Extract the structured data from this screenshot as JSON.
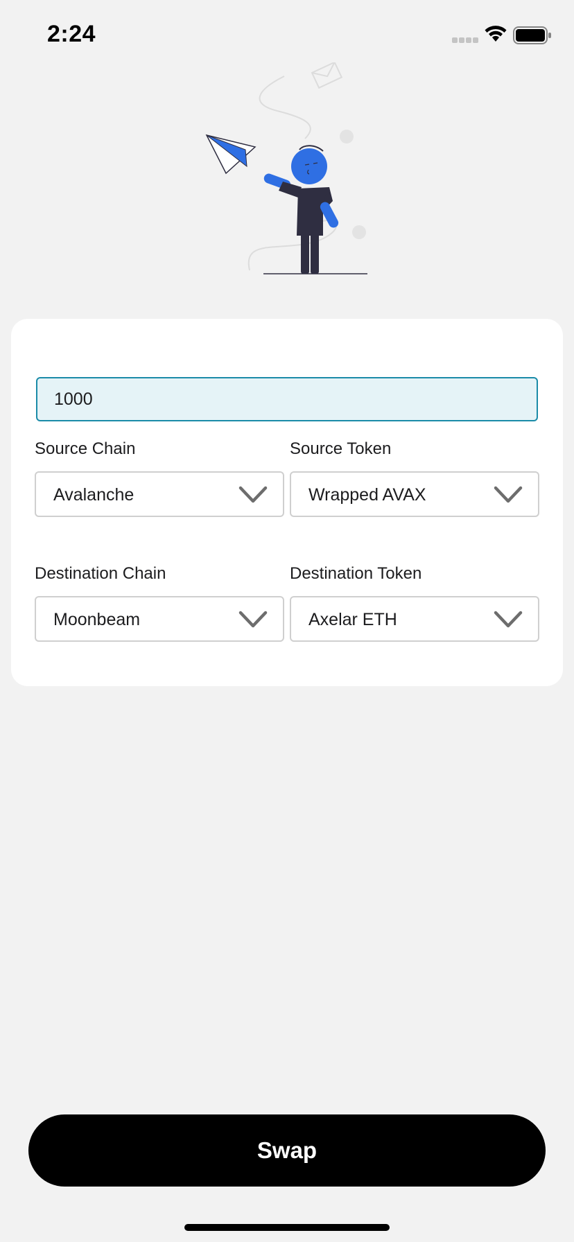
{
  "status_bar": {
    "time": "2:24",
    "icons": [
      "signal-icon",
      "wifi-icon",
      "battery-icon"
    ]
  },
  "hero": {
    "illustration": "person-sending-paper-plane",
    "accent_color": "#2f6fe3"
  },
  "form": {
    "amount": {
      "value": "1000",
      "placeholder": ""
    },
    "source_chain": {
      "label": "Source Chain",
      "selected": "Avalanche"
    },
    "source_token": {
      "label": "Source Token",
      "selected": "Wrapped AVAX"
    },
    "destination_chain": {
      "label": "Destination Chain",
      "selected": "Moonbeam"
    },
    "destination_token": {
      "label": "Destination Token",
      "selected": "Axelar ETH"
    }
  },
  "actions": {
    "swap_label": "Swap"
  },
  "colors": {
    "background": "#f2f2f2",
    "card": "#ffffff",
    "input_focus_border": "#1a8ba8",
    "input_focus_fill": "#e5f3f7",
    "button": "#000000",
    "figure_dark": "#2f2e41"
  }
}
